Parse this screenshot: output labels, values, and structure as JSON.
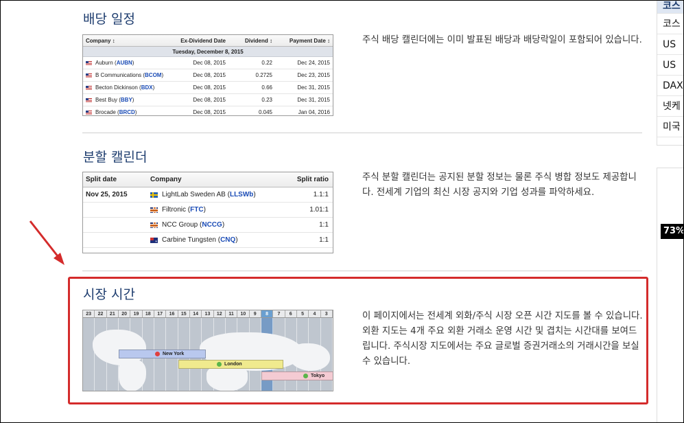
{
  "dividend": {
    "title": "배당 일정",
    "desc": "주식 배당 캘린더에는 이미 발표된 배당과 배당락일이 포함되어 있습니다.",
    "headers": {
      "company": "Company ↕",
      "exdate": "Ex-Dividend Date",
      "dividend": "Dividend ↕",
      "payment": "Payment Date ↕"
    },
    "date_row": "Tuesday, December 8, 2015",
    "rows": [
      {
        "name": "Auburn",
        "ticker": "AUBN",
        "exdate": "Dec 08, 2015",
        "dividend": "0.22",
        "payment": "Dec 24, 2015"
      },
      {
        "name": "B Communications",
        "ticker": "BCOM",
        "exdate": "Dec 08, 2015",
        "dividend": "0.2725",
        "payment": "Dec 23, 2015"
      },
      {
        "name": "Becton Dickinson",
        "ticker": "BDX",
        "exdate": "Dec 08, 2015",
        "dividend": "0.66",
        "payment": "Dec 31, 2015"
      },
      {
        "name": "Best Buy",
        "ticker": "BBY",
        "exdate": "Dec 08, 2015",
        "dividend": "0.23",
        "payment": "Dec 31, 2015"
      },
      {
        "name": "Brocade",
        "ticker": "BRCD",
        "exdate": "Dec 08, 2015",
        "dividend": "0.045",
        "payment": "Jan 04, 2016"
      }
    ]
  },
  "split": {
    "title": "분할 캘린더",
    "desc": "주식 분할 캘린더는 공지된 분할 정보는 물론 주식 병합 정보도 제공합니다. 전세계 기업의 최신 시장 공지와 기업 성과를 파악하세요.",
    "headers": {
      "date": "Split date",
      "company": "Company",
      "ratio": "Split ratio"
    },
    "date": "Nov 25, 2015",
    "rows": [
      {
        "flag": "se",
        "name": "LightLab Sweden AB",
        "ticker": "LLSWb",
        "ratio": "1.1:1"
      },
      {
        "flag": "gb",
        "name": "Filtronic",
        "ticker": "FTC",
        "ratio": "1.01:1"
      },
      {
        "flag": "gb",
        "name": "NCC Group",
        "ticker": "NCCG",
        "ratio": "1:1"
      },
      {
        "flag": "au",
        "name": "Carbine Tungsten",
        "ticker": "CNQ",
        "ratio": "1:1"
      }
    ]
  },
  "market": {
    "title": "시장 시간",
    "desc": "이 페이지에서는 전세계 외화/주식 시장 오픈 시간 지도를 볼 수 있습니다. 외환 지도는 4개 주요 외환 거래소 운영 시간 및 겹치는 시간대를 보여드립니다. 주식시장 지도에서는 주요 글로벌 증권거래소의 거래시간을 보실 수 있습니다.",
    "hours": [
      "23",
      "22",
      "21",
      "20",
      "19",
      "18",
      "17",
      "16",
      "15",
      "14",
      "13",
      "12",
      "11",
      "10",
      "9",
      "8",
      "7",
      "6",
      "5",
      "4",
      "3"
    ],
    "current_hour": "8",
    "bars": {
      "ny": "New York",
      "london": "London",
      "tokyo": "Tokyo"
    }
  },
  "sidebar": {
    "items": [
      "코스",
      "코스",
      "US",
      "US",
      "DAX",
      "넷케",
      "미국"
    ],
    "percent": "73%"
  },
  "colors": {
    "highlight": "#d42b2b",
    "title": "#1d3c6e"
  }
}
